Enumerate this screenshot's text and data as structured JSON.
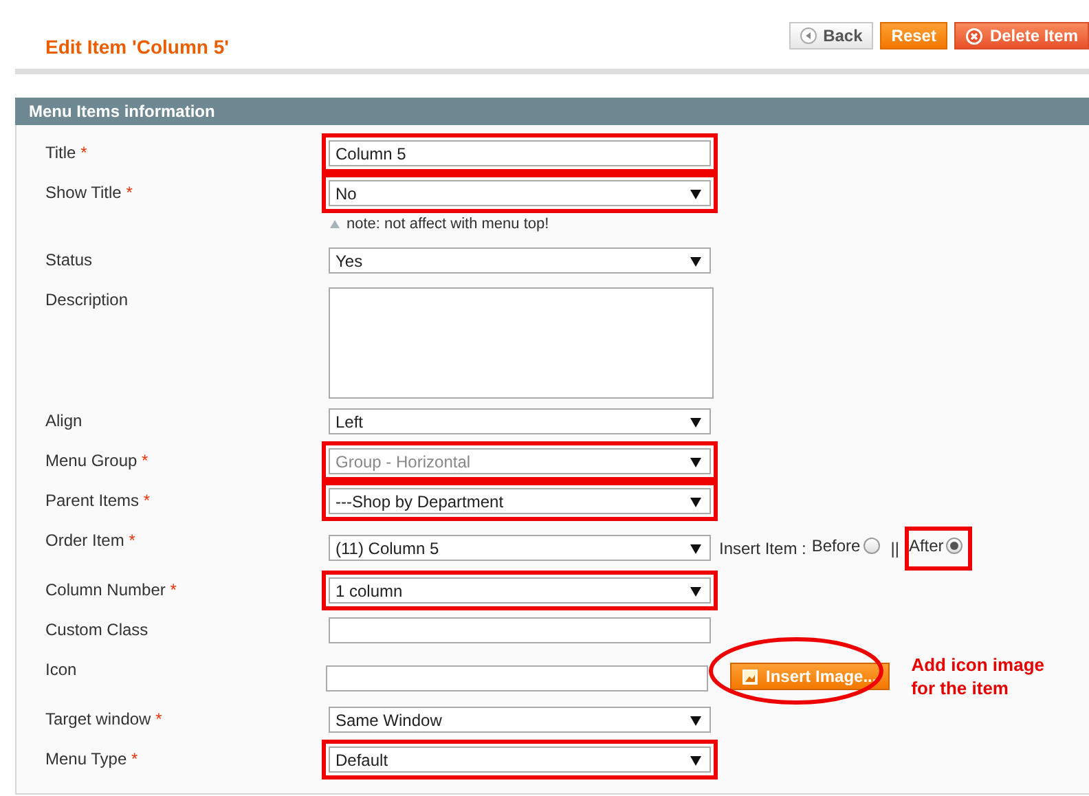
{
  "page_title": "Edit Item 'Column 5'",
  "buttons": [
    {
      "label": "Back",
      "kind": "back"
    },
    {
      "label": "Reset",
      "kind": "reset"
    },
    {
      "label": "Delete Item",
      "kind": "delete"
    }
  ],
  "section_title": "Menu Items information",
  "fields": [
    {
      "label": "Title",
      "mark": "*",
      "kind": "text",
      "value": "Column 5",
      "highlighted": true
    },
    {
      "label": "Show Title",
      "mark": "*",
      "kind": "select",
      "value": "No",
      "highlighted": true,
      "note": "note: not affect with menu top!"
    },
    {
      "label": "Status",
      "kind": "select",
      "value": "Yes",
      "highlighted": false
    },
    {
      "label": "Description",
      "kind": "textarea",
      "highlighted": false
    },
    {
      "label": "Align",
      "kind": "select",
      "value": "Left",
      "highlighted": false
    },
    {
      "label": "Menu Group",
      "mark": "*",
      "kind": "select",
      "value": "Group - Horizontal",
      "highlighted": true,
      "disabled": true
    },
    {
      "label": "Parent Items",
      "mark": "*",
      "kind": "select",
      "value": "---Shop by Department",
      "highlighted": true
    },
    {
      "label": "Order Item",
      "mark": "*",
      "kind": "order",
      "value": "(11) Column 5",
      "highlighted": false,
      "insert_label": "Insert Item :",
      "separator": "||",
      "options": [
        {
          "label": "Before",
          "selected": false,
          "highlighted": false
        },
        {
          "label": "After",
          "selected": true,
          "highlighted": true
        }
      ]
    },
    {
      "label": "Column Number",
      "mark": "*",
      "kind": "select",
      "value": "1 column",
      "highlighted": true
    },
    {
      "label": "Custom Class",
      "kind": "text",
      "highlighted": false
    },
    {
      "label": "Icon",
      "kind": "icon",
      "button": "Insert Image...",
      "annotation": "Add icon image for the item"
    },
    {
      "label": "Target window",
      "mark": "*",
      "kind": "select",
      "value": "Same Window",
      "highlighted": false
    },
    {
      "label": "Menu Type",
      "mark": "*",
      "kind": "select",
      "value": "Default",
      "highlighted": true
    }
  ]
}
